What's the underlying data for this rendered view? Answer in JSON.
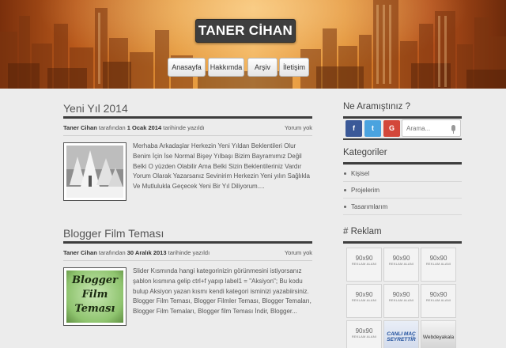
{
  "site": {
    "title": "TANER CİHAN"
  },
  "nav": [
    {
      "label": "Anasayfa"
    },
    {
      "label": "Hakkımda"
    },
    {
      "label": "Arşiv"
    },
    {
      "label": "İletişim"
    }
  ],
  "posts": [
    {
      "title": "Yeni Yıl 2014",
      "author": "Taner Cihan",
      "by_text": "tarafından",
      "date": "1 Ocak 2014",
      "date_suffix": "tarihinde yazıldı",
      "comments": "Yorum yok",
      "thumb_icon": "snowy-trees-image",
      "excerpt": "Merhaba Arkadaşlar Herkezin Yeni Yıldan Beklentileri Olur Benim İçin İse Normal Bişey Yılbaşı Bizim Bayramımız Değil Belki O yüzden Olabilir Ama Belki Sizin Beklentileriniz Vardır Yorum Olarak Yazarsanız Sevinirim Herkezin Yeni yılın Sağlıkla Ve Mutlulukla Geçecek Yeni Bir Yıl Diliyorum...."
    },
    {
      "title": "Blogger Film Teması",
      "author": "Taner Cihan",
      "by_text": "tarafından",
      "date": "30 Aralık 2013",
      "date_suffix": "tarihinde yazıldı",
      "comments": "Yorum yok",
      "thumb_lines": [
        "Blogger",
        "Film",
        "Teması"
      ],
      "excerpt": "Slider Kısmında hangi kategorinizin görünmesini istiyorsanız şablon kısmına gelip ctrl+f yapıp label1 = \"Aksiyon\"; Bu kodu bulup Aksiyon yazan kısmı kendi kategori isminizi yazabiirsiniz. Blogger Film Teması, Blogger Filmler Teması, Blogger Temaları, Blogger Film Temaları, Blogger film Teması İndir, Blogger..."
    }
  ],
  "sidebar": {
    "search": {
      "heading": "Ne Aramıştınız ?",
      "placeholder": "Arama...",
      "social": [
        {
          "name": "facebook",
          "glyph": "f",
          "color": "#3b5998"
        },
        {
          "name": "twitter",
          "glyph": "t",
          "color": "#4aa3df"
        },
        {
          "name": "google-plus",
          "glyph": "G",
          "color": "#d3473a"
        }
      ]
    },
    "categories": {
      "heading": "Kategoriler",
      "items": [
        "Kişisel",
        "Projelerim",
        "Tasarımlarım"
      ]
    },
    "ads": {
      "heading": "# Reklam",
      "items": [
        {
          "size": "90x90",
          "label": "REKLAM ALANI"
        },
        {
          "size": "90x90",
          "label": "REKLAM ALANI"
        },
        {
          "size": "90x90",
          "label": "REKLAM ALANI"
        },
        {
          "size": "90x90",
          "label": "REKLAM ALANI"
        },
        {
          "size": "90x90",
          "label": "REKLAM ALANI"
        },
        {
          "size": "90x90",
          "label": "REKLAM ALANI"
        },
        {
          "size": "90x90",
          "label": "REKLAM ALANI"
        }
      ],
      "canli_mac": [
        "CANLI MAÇ",
        "SEYRETTİR"
      ],
      "webdeyakala": "Webdeyakala"
    }
  }
}
